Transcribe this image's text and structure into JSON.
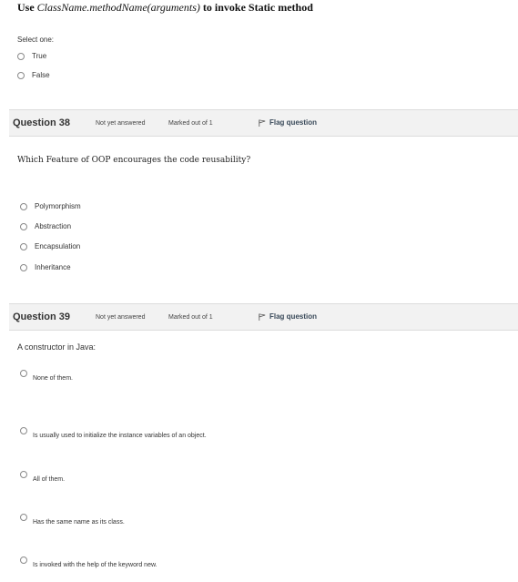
{
  "q37": {
    "title_prefix": "Use ",
    "title_code": "ClassName.methodName(arguments)",
    "title_suffix": " to invoke Static method",
    "select_one": "Select one:",
    "options": [
      "True",
      "False"
    ]
  },
  "q38": {
    "label": "Question",
    "number": "38",
    "state": "Not yet answered",
    "mark": "Marked out of 1",
    "flag_label": "Flag question",
    "text": "Which Feature of OOP encourages the code reusability?",
    "options": [
      "Polymorphism",
      "Abstraction",
      "Encapsulation",
      "Inheritance"
    ]
  },
  "q39": {
    "label": "Question",
    "number": "39",
    "state": "Not yet answered",
    "mark": "Marked out of 1",
    "flag_label": "Flag question",
    "text": "A constructor in Java:",
    "options": [
      "None of them.",
      "Is usually used to initialize the instance variables of an object.",
      "All of them.",
      "Has the same name as its class.",
      "Is invoked with the help of the keyword new."
    ]
  },
  "icons": {
    "flag": "flag-icon",
    "radio": "radio-icon"
  }
}
